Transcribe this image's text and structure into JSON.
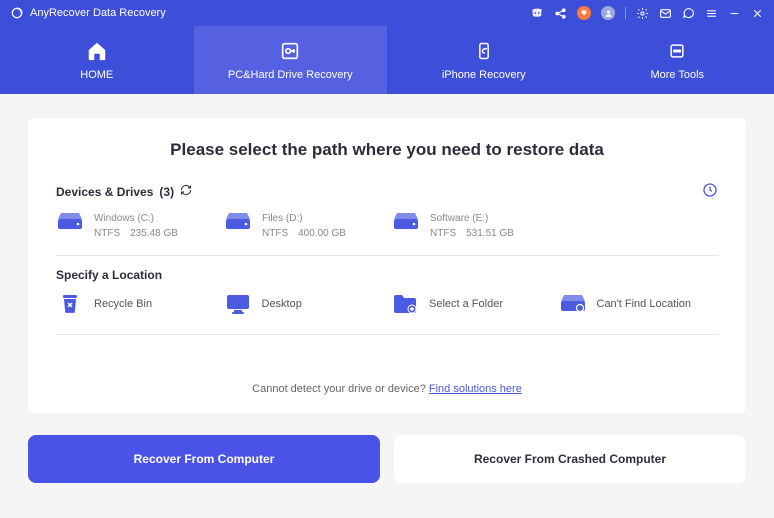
{
  "colors": {
    "accent": "#3d4ed8",
    "accent_light": "#5561e0",
    "button": "#4a53e8"
  },
  "titlebar": {
    "app_name": "AnyRecover Data Recovery"
  },
  "nav": {
    "tabs": [
      {
        "label": "HOME"
      },
      {
        "label": "PC&Hard Drive Recovery"
      },
      {
        "label": "iPhone Recovery"
      },
      {
        "label": "More Tools"
      }
    ]
  },
  "main": {
    "heading": "Please select the path where you need to restore data",
    "devices_header": "Devices & Drives",
    "devices_count": "(3)",
    "drives": [
      {
        "name": "Windows (C:)",
        "fs": "NTFS",
        "size": "235.48 GB"
      },
      {
        "name": "Files (D:)",
        "fs": "NTFS",
        "size": "400.00 GB"
      },
      {
        "name": "Software (E:)",
        "fs": "NTFS",
        "size": "531.51 GB"
      }
    ],
    "locations_header": "Specify a Location",
    "locations": [
      {
        "label": "Recycle Bin"
      },
      {
        "label": "Desktop"
      },
      {
        "label": "Select a Folder"
      },
      {
        "label": "Can't Find Location"
      }
    ],
    "detect_text": "Cannot detect your drive or device? ",
    "detect_link": "Find solutions here"
  },
  "buttons": {
    "primary": "Recover From Computer",
    "secondary": "Recover From Crashed Computer"
  }
}
